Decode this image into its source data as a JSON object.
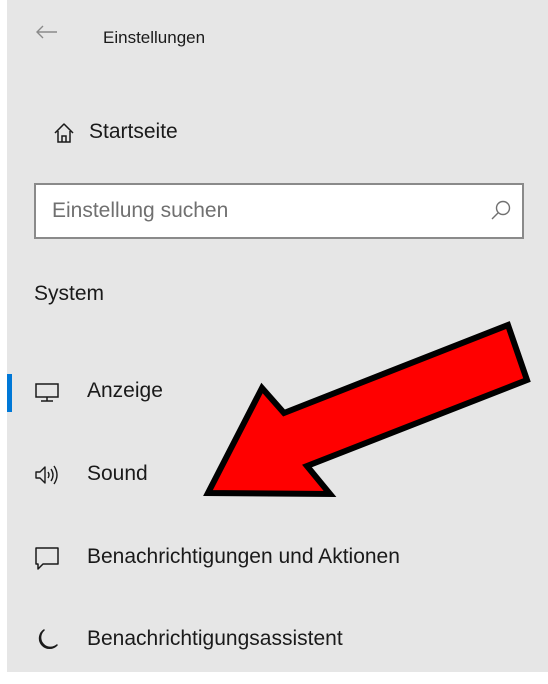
{
  "window": {
    "title": "Einstellungen"
  },
  "home": {
    "label": "Startseite",
    "icon": "home-icon"
  },
  "search": {
    "placeholder": "Einstellung suchen",
    "value": "",
    "icon": "search-icon"
  },
  "section": {
    "title": "System"
  },
  "nav": {
    "items": [
      {
        "label": "Anzeige",
        "icon": "monitor-icon",
        "selected": true
      },
      {
        "label": "Sound",
        "icon": "speaker-icon",
        "selected": false
      },
      {
        "label": "Benachrichtigungen und Aktionen",
        "icon": "notification-icon",
        "selected": false
      },
      {
        "label": "Benachrichtigungsassistent",
        "icon": "moon-icon",
        "selected": false
      }
    ]
  },
  "colors": {
    "panel_background": "#e6e6e6",
    "accent": "#0078d7",
    "annotation_arrow": "#ff0000"
  }
}
